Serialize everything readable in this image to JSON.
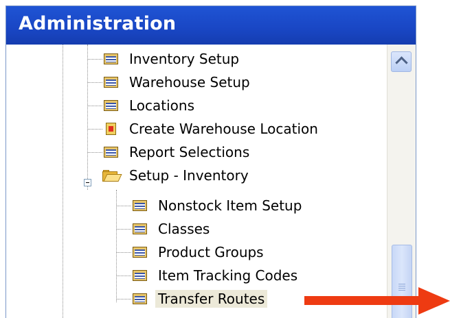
{
  "window": {
    "title": "Administration"
  },
  "tree": {
    "items": [
      {
        "label": "Inventory Setup",
        "icon": "form-icon"
      },
      {
        "label": "Warehouse Setup",
        "icon": "form-icon"
      },
      {
        "label": "Locations",
        "icon": "form-icon"
      },
      {
        "label": "Create Warehouse Location",
        "icon": "report-icon"
      },
      {
        "label": "Report Selections",
        "icon": "form-icon"
      },
      {
        "label": "Setup - Inventory",
        "icon": "folder-open-icon",
        "expanded": true
      },
      {
        "label": "Nonstock Item Setup",
        "icon": "form-icon"
      },
      {
        "label": "Classes",
        "icon": "form-icon"
      },
      {
        "label": "Product Groups",
        "icon": "form-icon"
      },
      {
        "label": "Item Tracking Codes",
        "icon": "form-icon"
      },
      {
        "label": "Transfer Routes",
        "icon": "form-icon",
        "selected": true
      }
    ]
  },
  "colors": {
    "title_bar": "#1946c4",
    "arrow": "#ee3b12"
  }
}
